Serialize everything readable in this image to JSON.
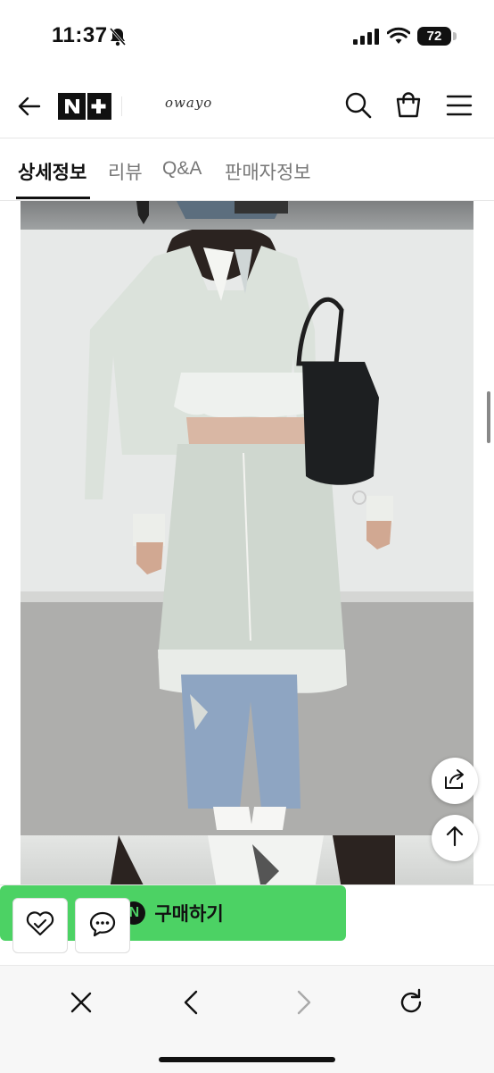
{
  "status": {
    "time": "11:37",
    "battery": "72"
  },
  "header": {
    "brand": "owayo",
    "store_logo": "N+"
  },
  "tabs": [
    {
      "label": "상세정보"
    },
    {
      "label": "리뷰"
    },
    {
      "label": "Q&A"
    },
    {
      "label": "판매자정보"
    }
  ],
  "footer": {
    "buy_label": "구매하기",
    "npay_badge": "N"
  },
  "icons": {
    "back": "arrow-left-icon",
    "search": "search-icon",
    "cart": "shopping-bag-icon",
    "menu": "hamburger-menu-icon",
    "share": "share-icon",
    "scroll_top": "arrow-up-icon",
    "wish": "heart-icon",
    "talk": "chat-icon",
    "close": "close-icon",
    "browser_back": "chevron-left-icon",
    "browser_forward": "chevron-right-icon",
    "reload": "reload-icon"
  },
  "colors": {
    "accent_green": "#4cd264",
    "text": "#111111",
    "muted": "#777777"
  }
}
